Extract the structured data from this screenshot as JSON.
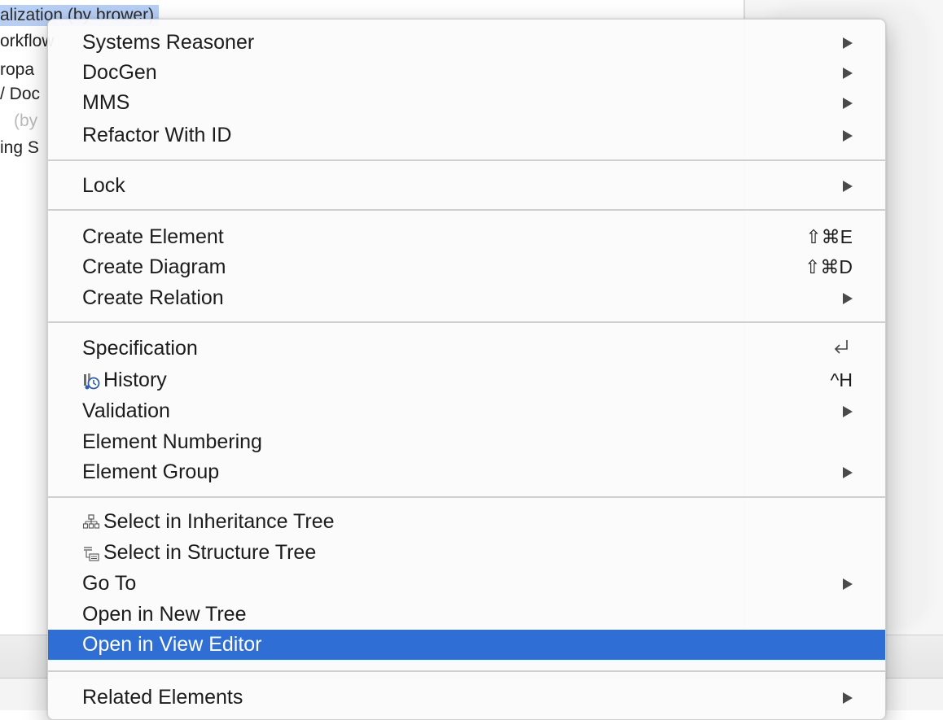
{
  "background": {
    "tree_items": [
      {
        "text": "alization (by brower)",
        "selected": true
      },
      {
        "text": "orkflow",
        "dark_part": "orkflow",
        "rest": ""
      },
      {
        "text": "ropa",
        "dark_part": "ropa",
        "rest": ""
      },
      {
        "text": "/ Doc",
        "dark_part": "/ Doc",
        "rest": ""
      },
      {
        "text": "(by",
        "dark_part": "",
        "rest": "(by"
      },
      {
        "text": "ing S",
        "dark_part": "ing S",
        "rest": ""
      }
    ]
  },
  "menu": {
    "items": [
      {
        "label": "Systems Reasoner",
        "submenu": true
      },
      {
        "label": "DocGen",
        "submenu": true
      },
      {
        "label": "MMS",
        "submenu": true
      },
      {
        "label": "Refactor With ID",
        "submenu": true
      },
      {
        "label": "Lock",
        "submenu": true
      },
      {
        "label": "Create Element",
        "shortcut": "⇧⌘E"
      },
      {
        "label": "Create Diagram",
        "shortcut": "⇧⌘D"
      },
      {
        "label": "Create Relation",
        "submenu": true
      },
      {
        "label": "Specification",
        "shortcut_icon": "return-icon"
      },
      {
        "label": "History",
        "icon": "history-icon",
        "shortcut": "^H"
      },
      {
        "label": "Validation",
        "submenu": true
      },
      {
        "label": "Element Numbering"
      },
      {
        "label": "Element Group",
        "submenu": true
      },
      {
        "label": "Select in Inheritance Tree",
        "icon": "inheritance-tree-icon"
      },
      {
        "label": "Select in Structure Tree",
        "icon": "structure-tree-icon"
      },
      {
        "label": "Go To",
        "submenu": true
      },
      {
        "label": "Open in New Tree"
      },
      {
        "label": "Open in View Editor",
        "highlighted": true
      },
      {
        "label": "Related Elements",
        "submenu": true
      }
    ]
  },
  "colors": {
    "highlight": "#2f6ed4",
    "selection": "#b7cff5"
  }
}
